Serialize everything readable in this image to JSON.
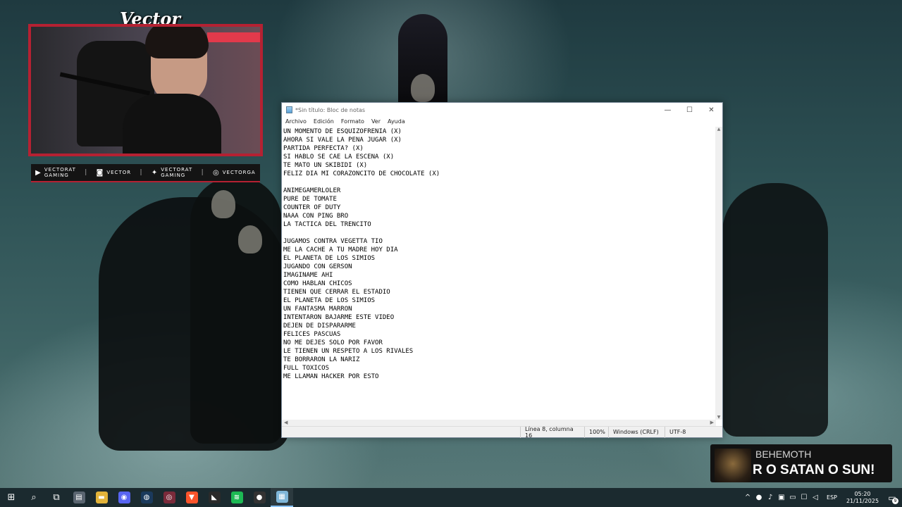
{
  "overlay": {
    "streamer_name": "Vector",
    "socials": [
      {
        "icon": "youtube-icon",
        "glyph": "▶",
        "line1": "VECTORAT",
        "line2": "GAMING"
      },
      {
        "icon": "twitch-icon",
        "glyph": "◙",
        "line1": "VECTOR",
        "line2": ""
      },
      {
        "icon": "twitter-icon",
        "glyph": "✦",
        "line1": "VECTORAT",
        "line2": "GAMING"
      },
      {
        "icon": "instagram-icon",
        "glyph": "◎",
        "line1": "VECTORGA",
        "line2": ""
      }
    ],
    "accent_color": "#b52132"
  },
  "notepad": {
    "title": "*Sin título: Bloc de notas",
    "controls": {
      "minimize": "—",
      "maximize": "☐",
      "close": "✕"
    },
    "menu": [
      "Archivo",
      "Edición",
      "Formato",
      "Ver",
      "Ayuda"
    ],
    "content": "UN MOMENTO DE ESQUIZOFRENIA (X)\nAHORA SI VALE LA PENA JUGAR (X)\nPARTIDA PERFECTA? (X)\nSI HABLO SE CAE LA ESCENA (X)\nTE MATO UN SKIBIDI (X)\nFELIZ DIA MI CORAZONCITO DE CHOCOLATE (X)\n\nANIMEGAMERLOLER\nPURE DE TOMATE\nCOUNTER OF DUTY\nNAAA CON PING BRO\nLA TACTICA DEL TRENCITO\n\nJUGAMOS CONTRA VEGETTA TIO\nME LA CACHE A TU MADRE HOY DIA\nEL PLANETA DE LOS SIMIOS\nJUGANDO CON GERSON\nIMAGINAME AHI\nCOMO HABLAN CHICOS\nTIENEN QUE CERRAR EL ESTADIO\nEL PLANETA DE LOS SIMIOS\nUN FANTASMA MARRON\nINTENTARON BAJARME ESTE VIDEO\nDEJEN DE DISPARARME\nFELICES PASCUAS\nNO ME DEJES SOLO POR FAVOR\nLE TIENEN UN RESPETO A LOS RIVALES\nTE BORRARON LA NARIZ\nFULL TOXICOS\nME LLAMAN HACKER POR ESTO",
    "status": {
      "position": "Línea 8, columna 16",
      "zoom": "100%",
      "line_ending": "Windows (CRLF)",
      "encoding": "UTF-8"
    }
  },
  "now_playing": {
    "artist": "BEHEMOTH",
    "song": "R O SATAN O SUN!"
  },
  "taskbar": {
    "apps": [
      {
        "name": "file-explorer-icon",
        "glyph": "▤",
        "color": "#5a6570"
      },
      {
        "name": "folder-icon",
        "glyph": "▬",
        "color": "#e2b33a"
      },
      {
        "name": "discord-icon",
        "glyph": "◉",
        "color": "#5865f2"
      },
      {
        "name": "steam-icon",
        "glyph": "◍",
        "color": "#1b3a5c"
      },
      {
        "name": "obs-icon",
        "glyph": "◎",
        "color": "#7a2a3a"
      },
      {
        "name": "brave-icon",
        "glyph": "▼",
        "color": "#fb542b"
      },
      {
        "name": "epic-games-icon",
        "glyph": "◣",
        "color": "#2a2a2a"
      },
      {
        "name": "spotify-icon",
        "glyph": "≋",
        "color": "#1db954"
      },
      {
        "name": "recorder-icon",
        "glyph": "●",
        "color": "#333"
      },
      {
        "name": "notepad-icon",
        "glyph": "▦",
        "color": "#7fb6d8"
      }
    ],
    "tray": {
      "language": "ESP",
      "time": "05:20",
      "date": "21/11/2025",
      "notifications": "9"
    }
  }
}
